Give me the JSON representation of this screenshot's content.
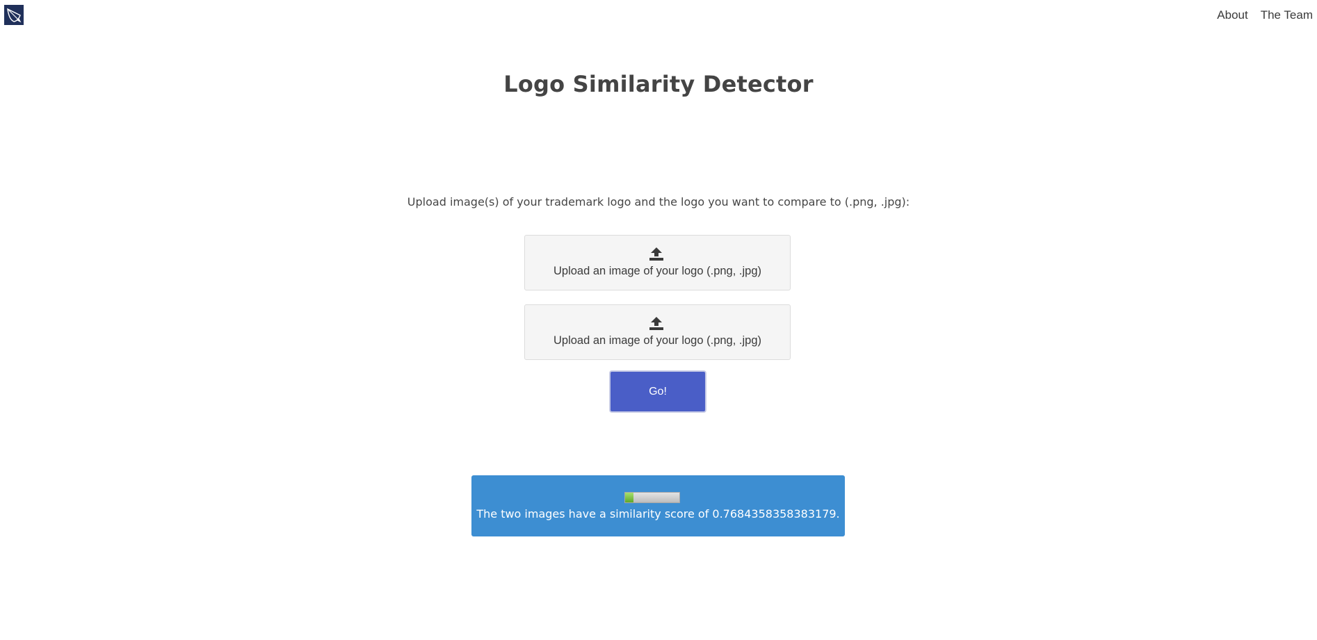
{
  "header": {
    "logo_icon": "bow-and-arrow-logo-icon",
    "nav": [
      {
        "label": "About"
      },
      {
        "label": "The Team"
      }
    ]
  },
  "main": {
    "title": "Logo Similarity Detector",
    "instructions": "Upload image(s) of your trademark logo and the logo you want to compare to (.png, .jpg):",
    "uploads": [
      {
        "icon": "upload-icon",
        "label": "Upload an image of your logo (.png, .jpg)"
      },
      {
        "icon": "upload-icon",
        "label": "Upload an image of your logo (.png, .jpg)"
      }
    ],
    "go_label": "Go!"
  },
  "result": {
    "score_fraction": 0.16,
    "text": "The two images have a similarity score of 0.7684358358383179."
  },
  "colors": {
    "accent_button": "#4a5ec7",
    "result_panel": "#3d8ed2",
    "logo_background": "#20305a",
    "progress_fill": "#7ac943"
  }
}
